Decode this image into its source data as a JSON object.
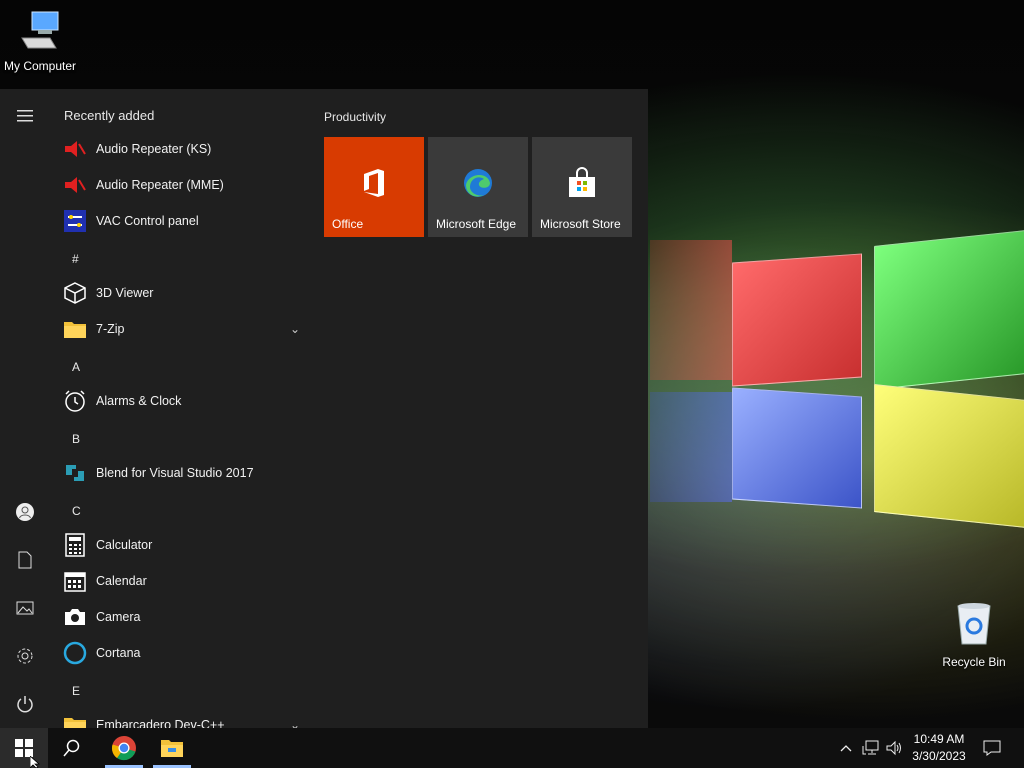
{
  "desktop": {
    "icons": [
      {
        "label": "My Computer",
        "icon": "computer-icon"
      },
      {
        "label": "Recycle Bin",
        "icon": "recycle-bin-icon"
      }
    ]
  },
  "start_menu": {
    "recently_added_header": "Recently added",
    "recent_apps": [
      {
        "label": "Audio Repeater (KS)",
        "icon": "audio-repeater-icon"
      },
      {
        "label": "Audio Repeater (MME)",
        "icon": "audio-repeater-icon"
      },
      {
        "label": "VAC Control panel",
        "icon": "vac-control-icon"
      }
    ],
    "groups": [
      {
        "letter": "#",
        "apps": [
          {
            "label": "3D Viewer",
            "icon": "cube-icon"
          },
          {
            "label": "7-Zip",
            "icon": "folder-icon",
            "expandable": true
          }
        ]
      },
      {
        "letter": "A",
        "apps": [
          {
            "label": "Alarms & Clock",
            "icon": "clock-icon"
          }
        ]
      },
      {
        "letter": "B",
        "apps": [
          {
            "label": "Blend for Visual Studio 2017",
            "icon": "blend-icon"
          }
        ]
      },
      {
        "letter": "C",
        "apps": [
          {
            "label": "Calculator",
            "icon": "calculator-icon"
          },
          {
            "label": "Calendar",
            "icon": "calendar-icon"
          },
          {
            "label": "Camera",
            "icon": "camera-icon"
          },
          {
            "label": "Cortana",
            "icon": "cortana-icon"
          }
        ]
      },
      {
        "letter": "E",
        "apps": [
          {
            "label": "Embarcadero Dev-C++",
            "icon": "folder-icon",
            "expandable": true
          }
        ]
      }
    ],
    "tiles_header": "Productivity",
    "tiles": [
      {
        "label": "Office",
        "icon": "office-icon",
        "bg": "#d83b01"
      },
      {
        "label": "Microsoft Edge",
        "icon": "edge-icon",
        "bg": "#3a3a3a"
      },
      {
        "label": "Microsoft Store",
        "icon": "store-icon",
        "bg": "#3a3a3a"
      }
    ]
  },
  "taskbar": {
    "clock_time": "10:49 AM",
    "clock_date": "3/30/2023"
  },
  "colors": {
    "accent": "#d83b01",
    "start_bg": "#1f1f1f",
    "taskbar_bg": "#101010"
  }
}
